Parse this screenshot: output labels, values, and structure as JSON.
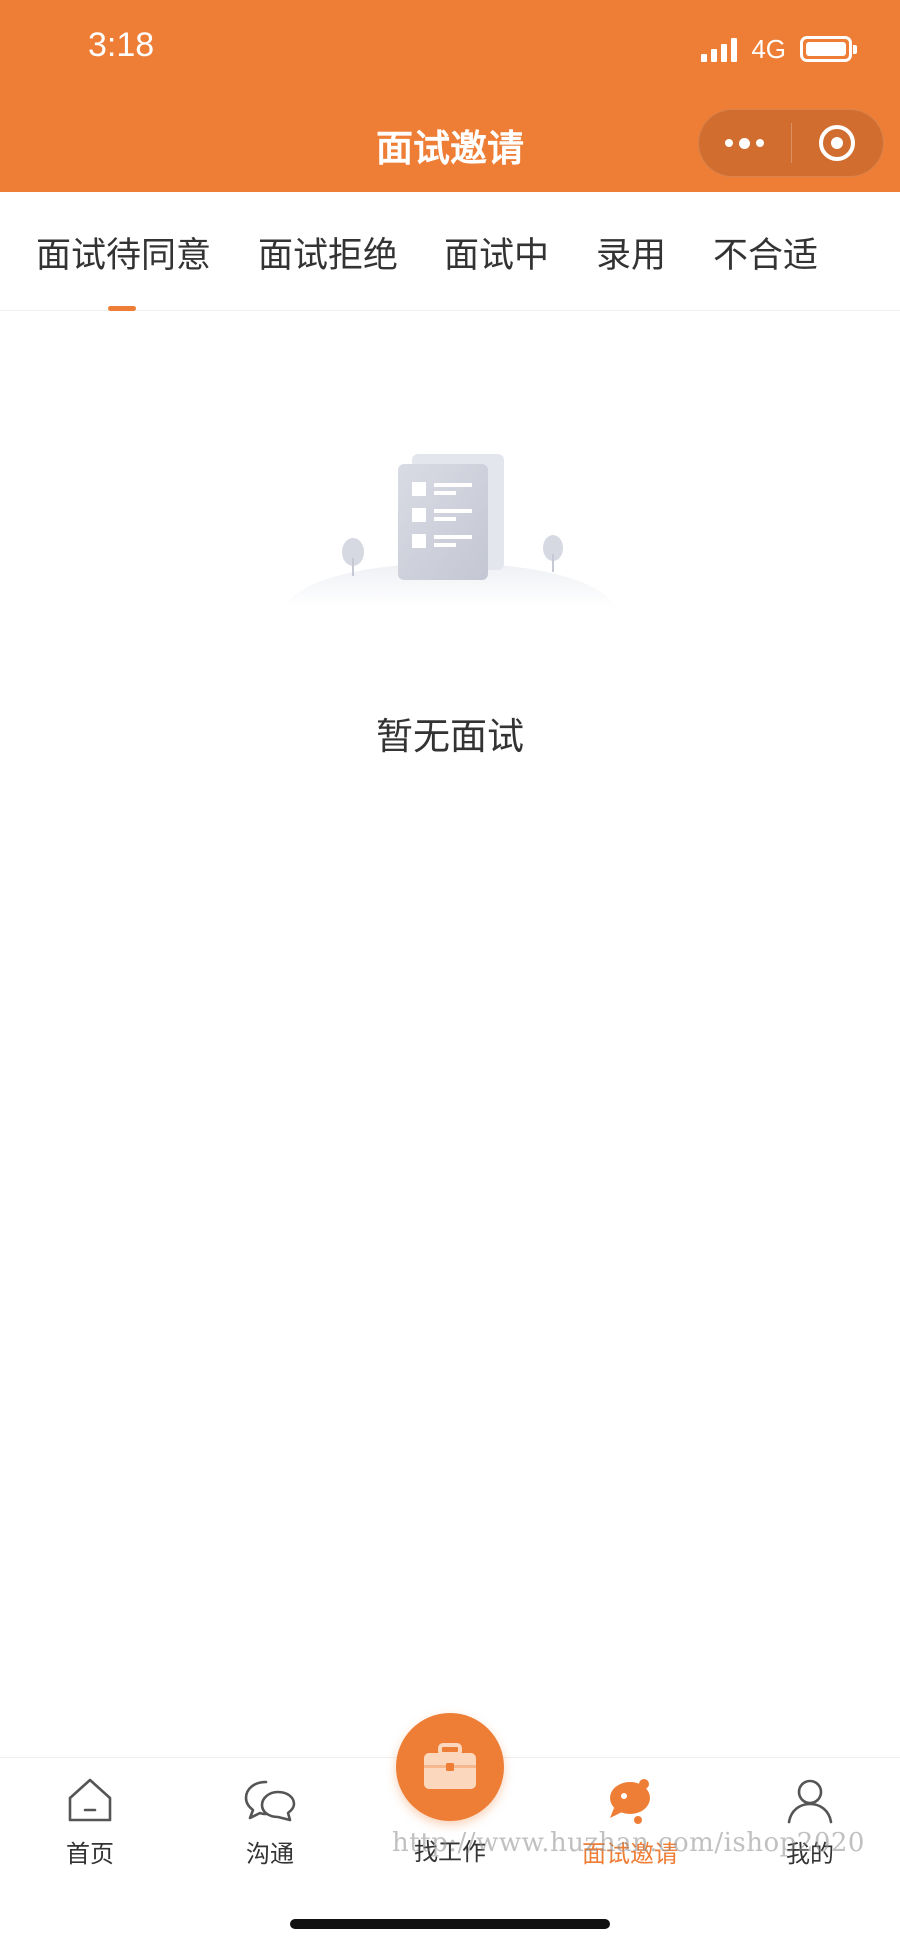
{
  "status_bar": {
    "time": "3:18",
    "network": "4G"
  },
  "header": {
    "title": "面试邀请"
  },
  "tabs": [
    {
      "label": "面试待同意",
      "active": true
    },
    {
      "label": "面试拒绝",
      "active": false
    },
    {
      "label": "面试中",
      "active": false
    },
    {
      "label": "录用",
      "active": false
    },
    {
      "label": "不合适",
      "active": false
    }
  ],
  "empty_state": {
    "message": "暂无面试"
  },
  "bottom_nav": [
    {
      "label": "首页",
      "icon": "home-icon",
      "active": false
    },
    {
      "label": "沟通",
      "icon": "chat-bubbles-icon",
      "active": false
    },
    {
      "label": "找工作",
      "icon": "briefcase-icon",
      "active": false
    },
    {
      "label": "面试邀请",
      "icon": "interview-bell-icon",
      "active": true
    },
    {
      "label": "我的",
      "icon": "user-icon",
      "active": false
    }
  ],
  "watermark": "http://www.huzhan.com/ishop2020",
  "colors": {
    "accent": "#EE7D35",
    "text": "#333333"
  }
}
